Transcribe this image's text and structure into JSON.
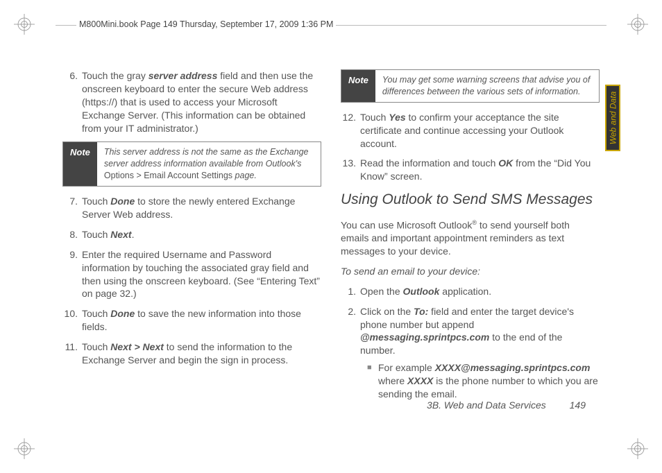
{
  "header": {
    "running": "M800Mini.book  Page 149  Thursday, September 17, 2009  1:36 PM"
  },
  "sideTab": {
    "label": "Web and Data"
  },
  "footer": {
    "section": "3B. Web and Data Services",
    "page": "149"
  },
  "left": {
    "item6": {
      "num": "6.",
      "pre": "Touch the gray ",
      "term": "server address",
      "post": " field and then use the onscreen keyboard to enter the secure Web address (https://) that is used to access your Microsoft Exchange Server. (This information can be obtained from your IT administrator.)"
    },
    "note1": {
      "label": "Note",
      "a": "This server address is not the same as the Exchange server address information available from Outlook's ",
      "b": "Options > Email Account Settings",
      "c": " page."
    },
    "item7": {
      "num": "7.",
      "a": "Touch ",
      "b": "Done",
      "c": " to store the newly entered Exchange Server Web address."
    },
    "item8": {
      "num": "8.",
      "a": "Touch ",
      "b": "Next",
      "c": "."
    },
    "item9": {
      "num": "9.",
      "a": "Enter the required Username and Password information by touching the associated gray field and then using the onscreen keyboard. (See “Entering Text” on page 32.)"
    },
    "item10": {
      "num": "10.",
      "a": "Touch ",
      "b": "Done",
      "c": " to save the new information into those fields."
    },
    "item11": {
      "num": "11.",
      "a": "Touch ",
      "b": "Next > Next",
      "c": " to send the information to the Exchange Server and begin the sign in process."
    }
  },
  "right": {
    "note2": {
      "label": "Note",
      "a": "You may get some warning screens that advise you of differences between the various sets of information."
    },
    "item12": {
      "num": "12.",
      "a": "Touch ",
      "b": "Yes",
      "c": " to confirm your acceptance the site certificate and continue accessing your Outlook account."
    },
    "item13": {
      "num": "13.",
      "a": "Read the information and touch ",
      "b": "OK",
      "c": " from the “Did You Know” screen."
    },
    "h2": "Using Outlook to Send SMS Messages",
    "intro": {
      "a": "You can use Microsoft Outlook",
      "sup": "®",
      "b": " to send yourself both emails and important appointment reminders as text messages to your device."
    },
    "sub": "To send an email to your device:",
    "s1": {
      "num": "1.",
      "a": "Open the ",
      "b": "Outlook",
      "c": " application."
    },
    "s2": {
      "num": "2.",
      "a": "Click on the ",
      "b": "To:",
      "c": " field and enter the target device's phone number but append ",
      "d": "@messaging.sprintpcs.com",
      "e": " to the end of the number."
    },
    "bullet": {
      "a": "For example ",
      "b": "XXXX@messaging.sprintpcs.com",
      "c": " where ",
      "d": "XXXX",
      "e": " is the phone number to which you are sending the email."
    }
  }
}
